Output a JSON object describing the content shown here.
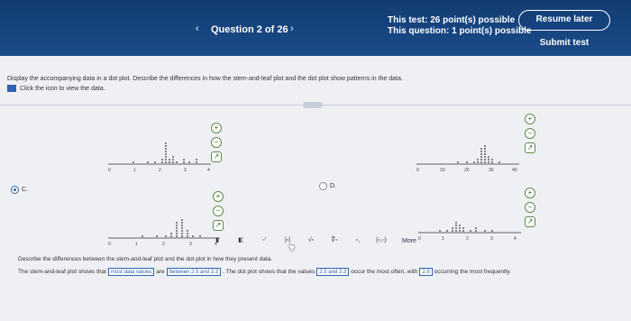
{
  "header": {
    "prev_icon": "‹",
    "question_label": "Question 2 of 26",
    "next_icon": "›",
    "test_points": "This test: 26 point(s) possible",
    "question_points": "This question: 1 point(s) possible",
    "resume_label": "Resume later",
    "submit_label": "Submit test"
  },
  "question": {
    "prompt": "Display the accompanying data in a dot plot. Describe the differences in how the stem-and-leaf plot and the dot plot show patterns in the data.",
    "data_link": "Click the icon to view the data."
  },
  "options": {
    "c_label": "C.",
    "d_label": "D.",
    "selected": "C"
  },
  "axis_ticks": {
    "left": [
      "0",
      "1",
      "2",
      "3",
      "4"
    ],
    "right": [
      "0",
      "10",
      "20",
      "30",
      "40"
    ]
  },
  "icons": {
    "zoom_in": "zoom-in-icon",
    "zoom_out": "zoom-out-icon",
    "external": "external-link-icon"
  },
  "describe_prompt": "Describe the differences between the stem-and-leaf plot and the dot plot in how they present data.",
  "answer": {
    "part1": "The stem-and-leaf plot shows that",
    "box1": "most data values",
    "part2": "are",
    "box2": "between 2.5 and 3.3",
    "part3": ". The dot plot shows that the values",
    "box3": "2.5 and 3.3",
    "part4": "occur the most often, with",
    "box4": "2.9",
    "part5": "occurring the most frequently."
  },
  "palette": {
    "buttons": [
      "▮",
      "▮¦",
      "▫'",
      "|▫|",
      "√▫",
      "∜▫",
      "▫,",
      "(▫,▫)"
    ],
    "more_label": "More"
  }
}
